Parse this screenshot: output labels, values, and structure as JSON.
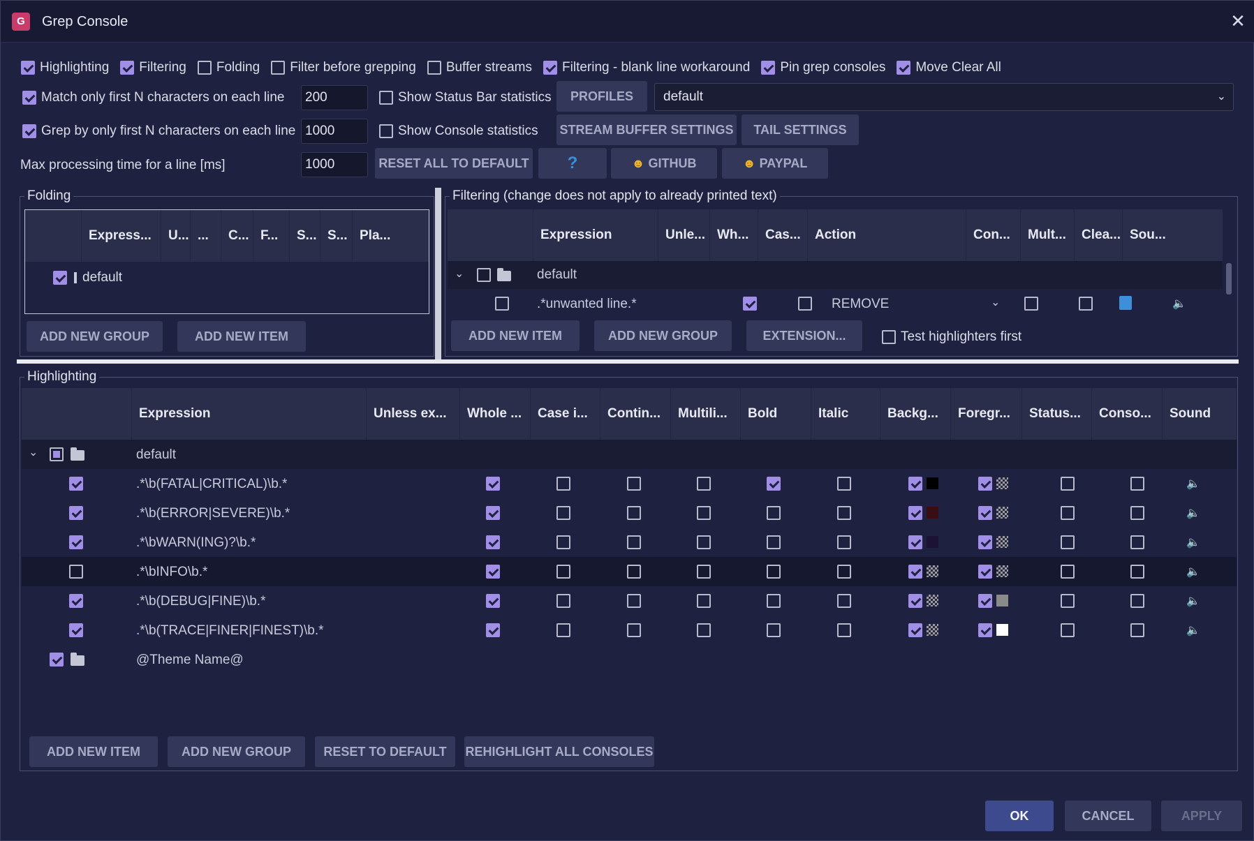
{
  "window": {
    "title": "Grep Console",
    "close": "✕"
  },
  "top": {
    "opts": [
      {
        "label": "Highlighting",
        "on": true
      },
      {
        "label": "Filtering",
        "on": true
      },
      {
        "label": "Folding",
        "on": false
      },
      {
        "label": "Filter before grepping",
        "on": false
      },
      {
        "label": "Buffer streams",
        "on": false
      },
      {
        "label": "Filtering - blank line workaround",
        "on": true
      },
      {
        "label": "Pin grep consoles",
        "on": true
      },
      {
        "label": "Move Clear All",
        "on": true
      }
    ],
    "match_first": "Match only first N characters on each line",
    "match_first_val": "200",
    "grep_first": "Grep by only first N characters on each line",
    "grep_first_val": "1000",
    "max_time": "Max processing time for a line [ms]",
    "max_time_val": "1000",
    "status_bar": "Show Status Bar statistics",
    "console_stats": "Show Console statistics",
    "profiles": "PROFILES",
    "profile_value": "default",
    "stream_buffer": "STREAM BUFFER SETTINGS",
    "tail": "TAIL SETTINGS",
    "reset_all": "RESET ALL TO DEFAULT",
    "help": "?",
    "github": "GITHUB",
    "paypal": "PAYPAL"
  },
  "folding": {
    "title": "Folding",
    "headers": [
      "Express...",
      "U...",
      "...",
      "C...",
      "F...",
      "S...",
      "S...",
      "Pla..."
    ],
    "row": "default",
    "add_group": "ADD NEW GROUP",
    "add_item": "ADD NEW ITEM"
  },
  "filtering": {
    "title": "Filtering (change does not apply to already printed text)",
    "headers": [
      "Expression",
      "Unle...",
      "Wh...",
      "Cas...",
      "Action",
      "Con...",
      "Mult...",
      "Clea...",
      "Sou..."
    ],
    "group": "default",
    "item": ".*unwanted line.*",
    "action": "REMOVE",
    "add_item": "ADD NEW ITEM",
    "add_group": "ADD NEW GROUP",
    "extension": "EXTENSION...",
    "test_first": "Test highlighters first"
  },
  "highlighting": {
    "title": "Highlighting",
    "headers": [
      "Expression",
      "Unless ex...",
      "Whole ...",
      "Case i...",
      "Contin...",
      "Multili...",
      "Bold",
      "Italic",
      "Backg...",
      "Foregr...",
      "Status...",
      "Conso...",
      "Sound"
    ],
    "group": "default",
    "rows": [
      {
        "expr": ".*\\b(FATAL|CRITICAL)\\b.*",
        "enabled": true,
        "bold": true,
        "bg": "#000000",
        "fg": "checker"
      },
      {
        "expr": ".*\\b(ERROR|SEVERE)\\b.*",
        "enabled": true,
        "bold": false,
        "bg": "#3a0d14",
        "fg": "checker"
      },
      {
        "expr": ".*\\bWARN(ING)?\\b.*",
        "enabled": true,
        "bold": false,
        "bg": "#1c1236",
        "fg": "checker"
      },
      {
        "expr": ".*\\bINFO\\b.*",
        "enabled": false,
        "bold": false,
        "bg": "checker",
        "fg": "checker"
      },
      {
        "expr": ".*\\b(DEBUG|FINE)\\b.*",
        "enabled": true,
        "bold": false,
        "bg": "checker",
        "fg": "#8a8a8a"
      },
      {
        "expr": ".*\\b(TRACE|FINER|FINEST)\\b.*",
        "enabled": true,
        "bold": false,
        "bg": "checker",
        "fg": "#ffffff"
      }
    ],
    "theme": "@Theme Name@",
    "add_item": "ADD NEW ITEM",
    "add_group": "ADD NEW GROUP",
    "reset": "RESET TO DEFAULT",
    "rehighlight": "REHIGHLIGHT ALL CONSOLES"
  },
  "footer": {
    "ok": "OK",
    "cancel": "CANCEL",
    "apply": "APPLY"
  }
}
